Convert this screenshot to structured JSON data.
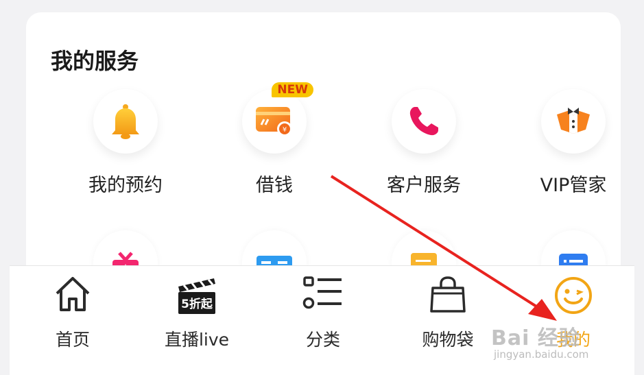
{
  "services": {
    "title": "我的服务",
    "items": [
      {
        "label": "我的预约",
        "icon": "bell-icon"
      },
      {
        "label": "借钱",
        "icon": "card-icon",
        "badge": "NEW"
      },
      {
        "label": "客户服务",
        "icon": "phone-icon"
      },
      {
        "label": "VIP管家",
        "icon": "butler-icon"
      }
    ],
    "row2_icons": [
      "gift-icon",
      "book-icon",
      "note-icon",
      "list-icon"
    ]
  },
  "tabbar": {
    "items": [
      {
        "label": "首页",
        "icon": "home-icon"
      },
      {
        "label": "直播live",
        "icon": "clapper-icon",
        "icon_text": "5折起"
      },
      {
        "label": "分类",
        "icon": "category-icon"
      },
      {
        "label": "购物袋",
        "icon": "bag-icon"
      },
      {
        "label": "我的",
        "icon": "smiley-icon",
        "active": true
      }
    ]
  },
  "watermark": {
    "text": "Bai 经验",
    "sub": "jingyan.baidu.com"
  },
  "colors": {
    "accent": "#f2a515",
    "arrow": "#e8231f"
  }
}
